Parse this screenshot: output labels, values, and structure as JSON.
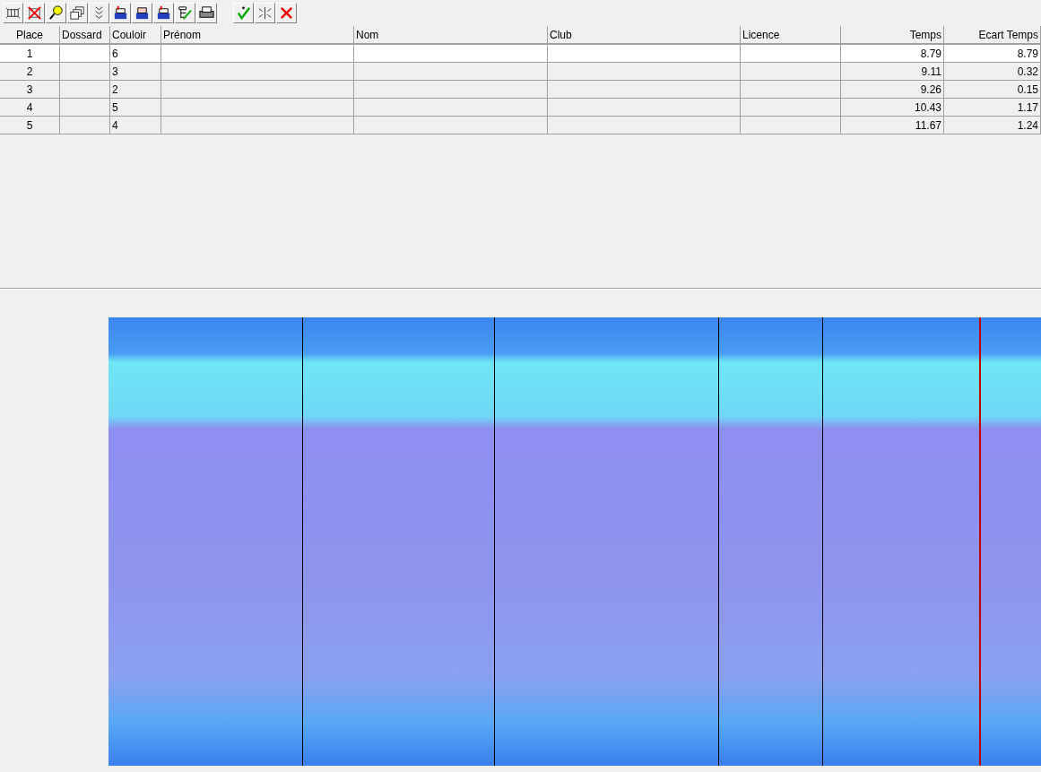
{
  "table": {
    "columns": [
      "Place",
      "Dossard",
      "Couloir",
      "Prénom",
      "Nom",
      "Club",
      "Licence",
      "Temps",
      "Ecart Temps"
    ],
    "rows": [
      {
        "selected": true,
        "cells": [
          "1",
          "",
          "6",
          "",
          "",
          "",
          "",
          "8.79",
          "8.79"
        ]
      },
      {
        "selected": false,
        "cells": [
          "2",
          "",
          "3",
          "",
          "",
          "",
          "",
          "9.11",
          "0.32"
        ]
      },
      {
        "selected": false,
        "cells": [
          "3",
          "",
          "2",
          "",
          "",
          "",
          "",
          "9.26",
          "0.15"
        ]
      },
      {
        "selected": false,
        "cells": [
          "4",
          "",
          "5",
          "",
          "",
          "",
          "",
          "10.43",
          "1.17"
        ]
      },
      {
        "selected": false,
        "cells": [
          "5",
          "",
          "4",
          "",
          "",
          "",
          "",
          "11.67",
          "1.24"
        ]
      }
    ]
  }
}
